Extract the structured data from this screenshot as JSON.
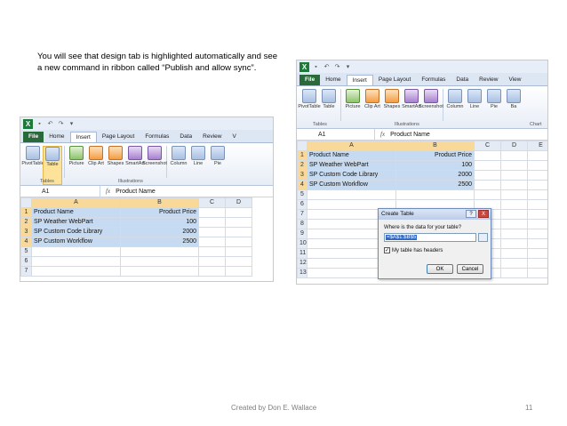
{
  "slide": {
    "intro_text": "You will see that design tab is highlighted automatically and see a new command in ribbon called “Publish and allow sync”.",
    "credit": "Created by Don E. Wallace",
    "page_number": "11"
  },
  "excel_left": {
    "tabs": [
      "File",
      "Home",
      "Insert",
      "Page Layout",
      "Formulas",
      "Data",
      "Review",
      "V"
    ],
    "active_tab": "Insert",
    "ribbon_buttons": [
      {
        "label": "PivotTable",
        "icon": "pivottable-icon"
      },
      {
        "label": "Table",
        "icon": "table-icon"
      },
      {
        "label": "Picture",
        "icon": "picture-icon"
      },
      {
        "label": "Clip Art",
        "icon": "clipart-icon"
      },
      {
        "label": "Shapes",
        "icon": "shapes-icon"
      },
      {
        "label": "SmartArt",
        "icon": "smartart-icon"
      },
      {
        "label": "Screenshot",
        "icon": "screenshot-icon"
      },
      {
        "label": "Column",
        "icon": "column-chart-icon"
      },
      {
        "label": "Line",
        "icon": "line-chart-icon"
      },
      {
        "label": "Pie",
        "icon": "pie-chart-icon"
      }
    ],
    "groups": [
      "Tables",
      "Illustrations"
    ],
    "name_box": "A1",
    "formula_value": "Product Name",
    "columns": [
      "A",
      "B",
      "C",
      "D"
    ],
    "rows": [
      [
        "1",
        "Product Name",
        "Product Price",
        "",
        ""
      ],
      [
        "2",
        "SP Weather WebPart",
        "100",
        "",
        ""
      ],
      [
        "3",
        "SP Custom Code Library",
        "2000",
        "",
        ""
      ],
      [
        "4",
        "SP Custom Workflow",
        "2500",
        "",
        ""
      ],
      [
        "5",
        "",
        "",
        "",
        ""
      ],
      [
        "6",
        "",
        "",
        "",
        ""
      ],
      [
        "7",
        "",
        "",
        "",
        ""
      ]
    ]
  },
  "excel_right": {
    "tabs": [
      "File",
      "Home",
      "Insert",
      "Page Layout",
      "Formulas",
      "Data",
      "Review",
      "View"
    ],
    "active_tab": "Insert",
    "ribbon_buttons": [
      {
        "label": "PivotTable",
        "icon": "pivottable-icon"
      },
      {
        "label": "Table",
        "icon": "table-icon"
      },
      {
        "label": "Picture",
        "icon": "picture-icon"
      },
      {
        "label": "Clip Art",
        "icon": "clipart-icon"
      },
      {
        "label": "Shapes",
        "icon": "shapes-icon"
      },
      {
        "label": "SmartArt",
        "icon": "smartart-icon"
      },
      {
        "label": "Screenshot",
        "icon": "screenshot-icon"
      },
      {
        "label": "Column",
        "icon": "column-chart-icon"
      },
      {
        "label": "Line",
        "icon": "line-chart-icon"
      },
      {
        "label": "Pie",
        "icon": "pie-chart-icon"
      },
      {
        "label": "Ba",
        "icon": "bar-chart-icon"
      }
    ],
    "groups": [
      "Tables",
      "Illustrations",
      "Chart"
    ],
    "name_box": "A1",
    "formula_value": "Product Name",
    "columns": [
      "A",
      "B",
      "C",
      "D",
      "E"
    ],
    "rows": [
      [
        "1",
        "Product Name",
        "Product Price",
        "",
        "",
        ""
      ],
      [
        "2",
        "SP Weather WebPart",
        "100",
        "",
        "",
        ""
      ],
      [
        "3",
        "SP Custom Code Library",
        "2000",
        "",
        "",
        ""
      ],
      [
        "4",
        "SP Custom Workflow",
        "2500",
        "",
        "",
        ""
      ],
      [
        "5",
        "",
        "",
        "",
        "",
        ""
      ],
      [
        "6",
        "",
        "",
        "",
        "",
        ""
      ],
      [
        "7",
        "",
        "",
        "",
        "",
        ""
      ],
      [
        "8",
        "",
        "",
        "",
        "",
        ""
      ],
      [
        "9",
        "",
        "",
        "",
        "",
        ""
      ],
      [
        "10",
        "",
        "",
        "",
        "",
        ""
      ],
      [
        "11",
        "",
        "",
        "",
        "",
        ""
      ],
      [
        "12",
        "",
        "",
        "",
        "",
        ""
      ],
      [
        "13",
        "",
        "",
        "",
        "",
        ""
      ]
    ],
    "dialog": {
      "title": "Create Table",
      "help_label": "?",
      "close_label": "X",
      "prompt": "Where is the data for your table?",
      "range_value": "=$A$1:$B$5",
      "headers_label": "My table has headers",
      "headers_checked": "✓",
      "ok_label": "OK",
      "cancel_label": "Cancel"
    }
  }
}
